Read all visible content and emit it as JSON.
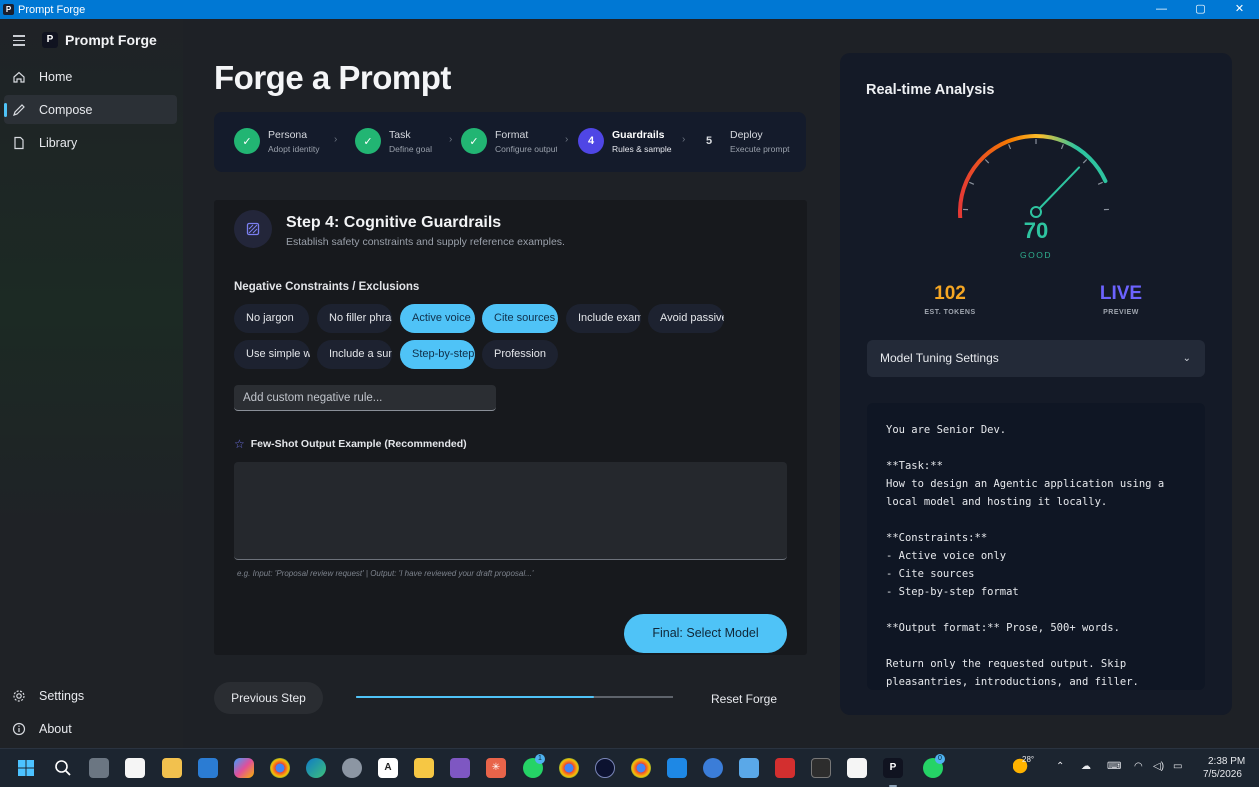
{
  "window": {
    "title": "Prompt Forge",
    "controls": [
      "—",
      "▢",
      "✕"
    ]
  },
  "sidebar": {
    "brand": "Prompt Forge",
    "logo_letter": "P",
    "items": [
      {
        "label": "Home",
        "icon": "home-icon"
      },
      {
        "label": "Compose",
        "icon": "pencil-icon",
        "active": true
      },
      {
        "label": "Library",
        "icon": "document-icon"
      }
    ],
    "footer": [
      {
        "label": "Settings",
        "icon": "gear-icon"
      },
      {
        "label": "About",
        "icon": "info-icon"
      }
    ]
  },
  "main": {
    "title": "Forge a Prompt",
    "steps": [
      {
        "num": "✓",
        "label": "Persona",
        "sub": "Adopt identity",
        "state": "done"
      },
      {
        "num": "✓",
        "label": "Task",
        "sub": "Define goal",
        "state": "done"
      },
      {
        "num": "✓",
        "label": "Format",
        "sub": "Configure output",
        "state": "done"
      },
      {
        "num": "4",
        "label": "Guardrails",
        "sub": "Rules & samples",
        "state": "current"
      },
      {
        "num": "5",
        "label": "Deploy",
        "sub": "Execute prompt",
        "state": "todo"
      }
    ],
    "card": {
      "title": "Step 4: Cognitive Guardrails",
      "subtitle": "Establish safety constraints and supply reference examples.",
      "constraints_label": "Negative Constraints / Exclusions",
      "chips": [
        {
          "label": "No jargon",
          "selected": false
        },
        {
          "label": "No filler phrases",
          "selected": false
        },
        {
          "label": "Active voice",
          "selected": true
        },
        {
          "label": "Cite sources",
          "selected": true
        },
        {
          "label": "Include examples",
          "selected": false
        },
        {
          "label": "Avoid passive",
          "selected": false
        },
        {
          "label": "Use simple words",
          "selected": false
        },
        {
          "label": "Include a summary",
          "selected": false
        },
        {
          "label": "Step-by-step",
          "selected": true
        },
        {
          "label": "Profession",
          "selected": false
        }
      ],
      "custom_rule_placeholder": "Add custom negative rule...",
      "fewshot_label": "Few-Shot Output Example (Recommended)",
      "example_value": "",
      "hint": "e.g. Input: 'Proposal review request' | Output: 'I have reviewed your draft proposal...'",
      "final_button": "Final: Select Model"
    },
    "footer": {
      "prev_button": "Previous Step",
      "progress": 0.75,
      "reset_button": "Reset Forge"
    }
  },
  "analysis": {
    "title": "Real-time Analysis",
    "score": "70",
    "score_label": "GOOD",
    "score_value": 70,
    "tokens_value": "102",
    "tokens_label": "EST. TOKENS",
    "preview_value": "LIVE",
    "preview_label": "PREVIEW",
    "tuning_label": "Model Tuning Settings",
    "preview_text": "You are Senior Dev.\n\n**Task:**\nHow to design an Agentic application using a local model and hosting it locally.\n\n**Constraints:**\n- Active voice only\n- Cite sources\n- Step-by-step format\n\n**Output format:** Prose, 500+ words.\n\nReturn only the requested output. Skip pleasantries, introductions, and filler."
  },
  "taskbar": {
    "weather_temp": "28°",
    "time": "2:38 PM",
    "date": "7/5/2026",
    "whatsapp_badge": "1",
    "whatsapp2_badge": "0"
  },
  "colors": {
    "accent": "#4fc3f7",
    "success": "#22b573",
    "current_step": "#4f46e5",
    "tokens": "#f5a623",
    "live": "#6c63ff"
  }
}
